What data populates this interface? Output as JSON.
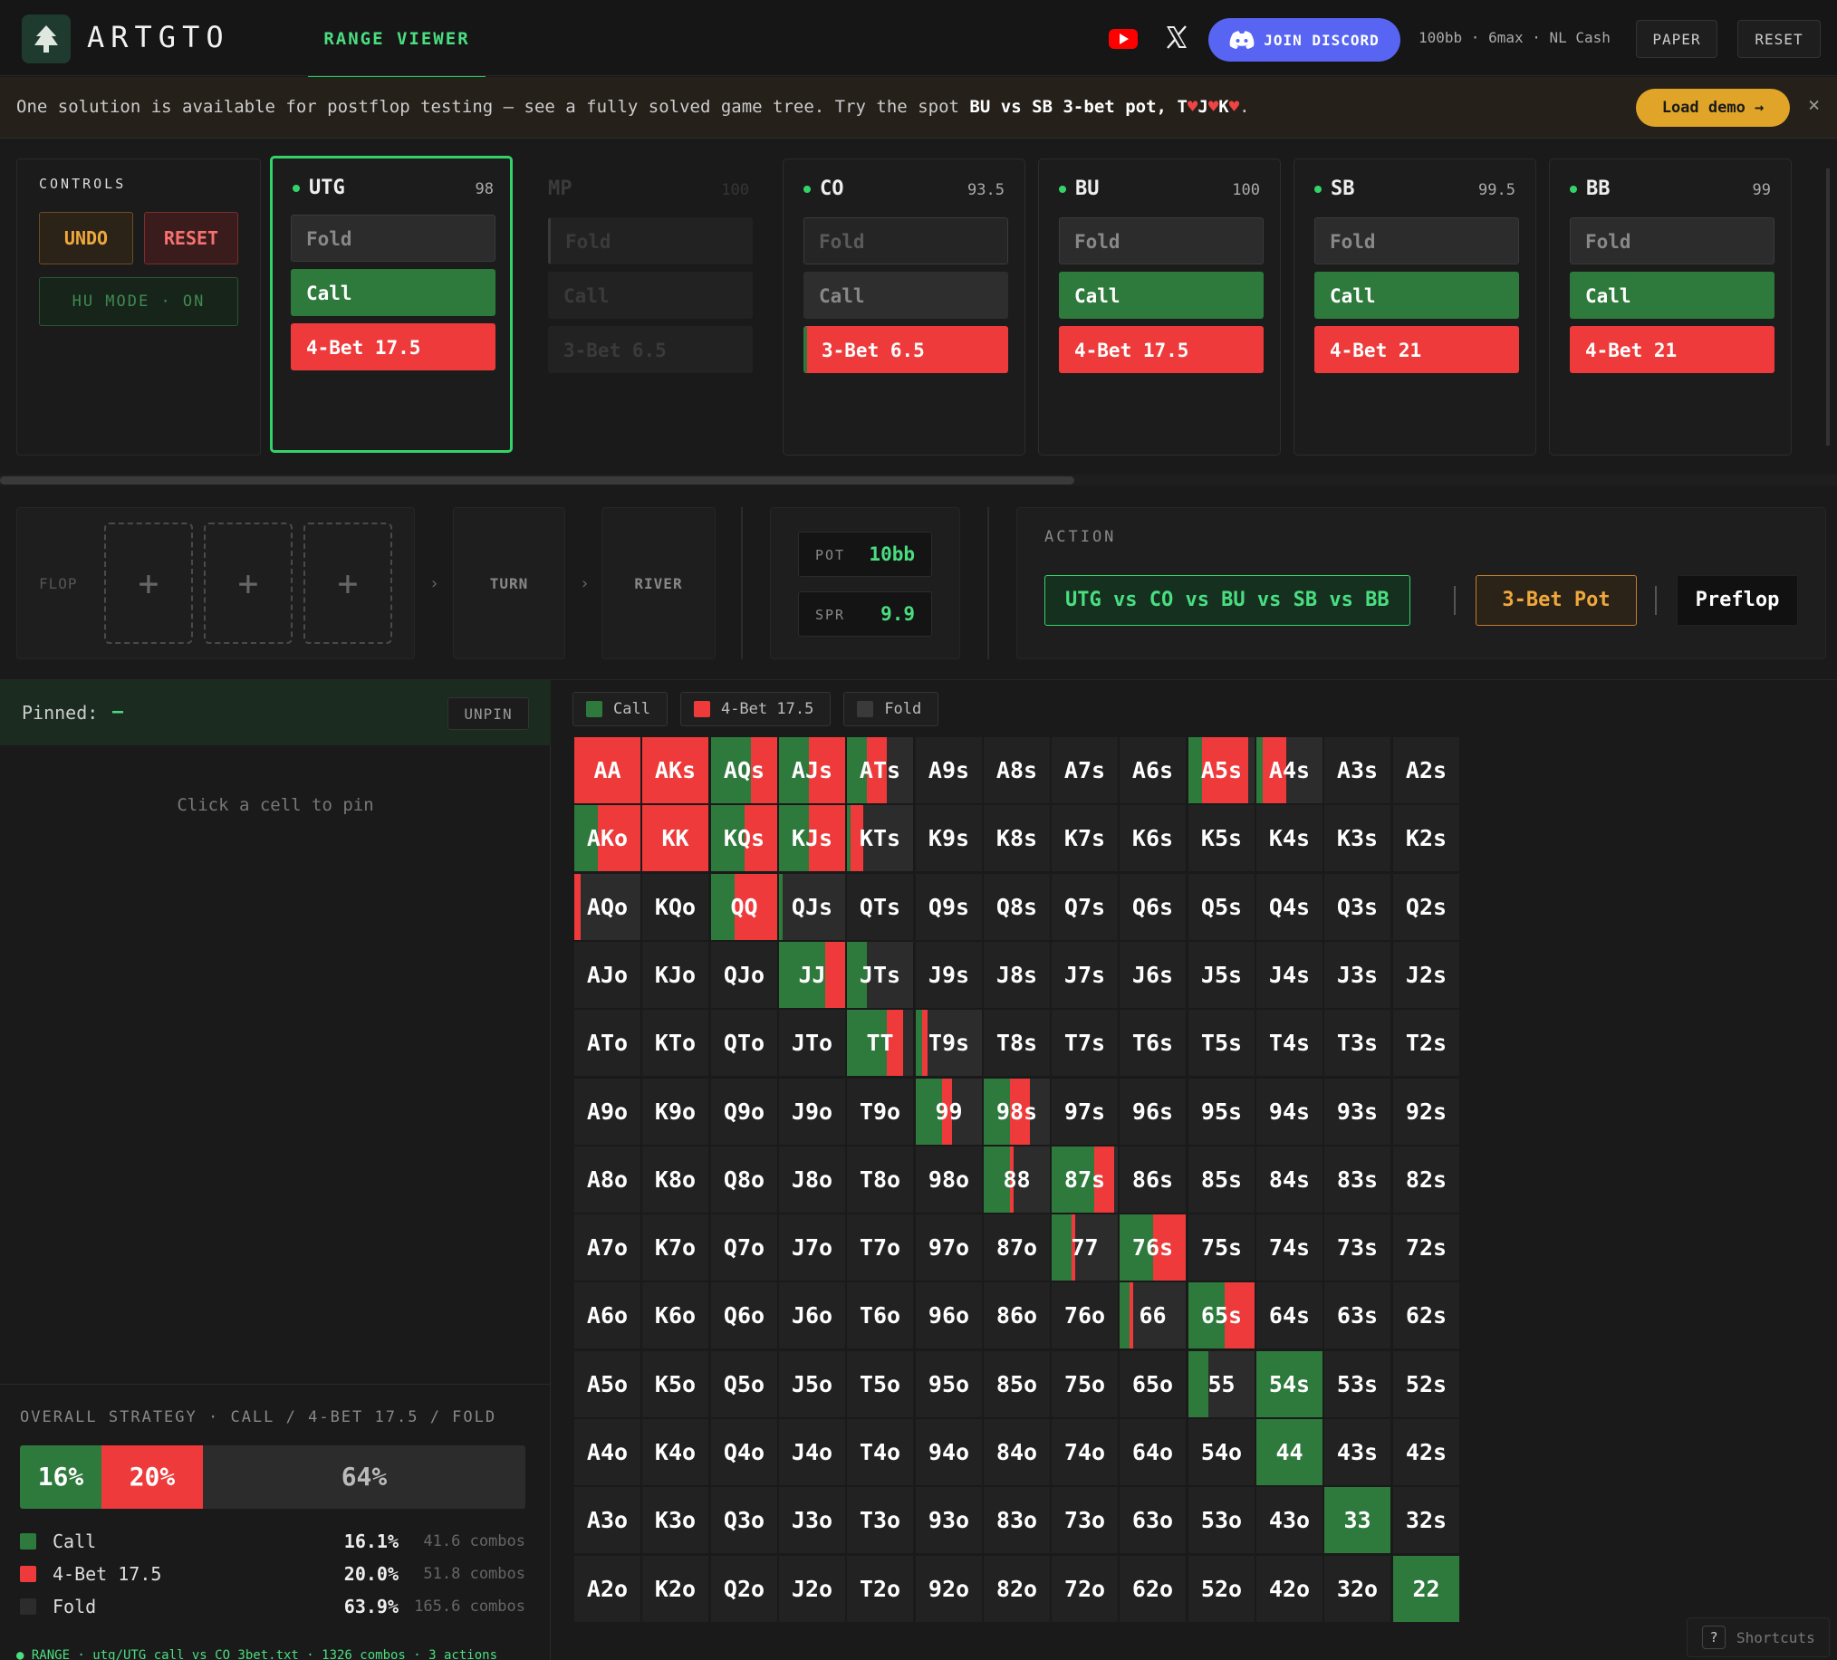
{
  "header": {
    "brand": "ARTGTO",
    "nav_tab": "RANGE VIEWER",
    "discord_label": "JOIN DISCORD",
    "game_info": "100bb · 6max · NL Cash",
    "paper_label": "PAPER",
    "reset_label": "RESET"
  },
  "banner": {
    "text_before": "One solution is available for postflop testing — see a fully solved game tree. Try the spot ",
    "spot": "BU vs SB 3-bet pot, T♥J♥K♥",
    "text_after": ".",
    "load_demo_label": "Load demo →",
    "close_label": "×"
  },
  "controls": {
    "title": "CONTROLS",
    "undo_label": "UNDO",
    "reset_label": "RESET",
    "hu_label": "HU MODE · ON"
  },
  "positions": [
    {
      "name": "UTG",
      "stack": "98",
      "actions": [
        "Fold",
        "Call",
        "4-Bet 17.5"
      ]
    },
    {
      "name": "MP",
      "stack": "100",
      "actions": [
        "Fold",
        "Call",
        "3-Bet 6.5"
      ]
    },
    {
      "name": "CO",
      "stack": "93.5",
      "actions": [
        "Fold",
        "Call",
        "3-Bet 6.5"
      ]
    },
    {
      "name": "BU",
      "stack": "100",
      "actions": [
        "Fold",
        "Call",
        "4-Bet 17.5"
      ]
    },
    {
      "name": "SB",
      "stack": "99.5",
      "actions": [
        "Fold",
        "Call",
        "4-Bet 21"
      ]
    },
    {
      "name": "BB",
      "stack": "99",
      "actions": [
        "Fold",
        "Call",
        "4-Bet 21"
      ]
    }
  ],
  "board": {
    "flop_label": "FLOP",
    "turn_label": "TURN",
    "river_label": "RIVER",
    "add_symbol": "+",
    "chevron": "›"
  },
  "pot": {
    "pot_label": "POT",
    "pot_value": "10bb",
    "spr_label": "SPR",
    "spr_value": "9.9"
  },
  "action": {
    "title": "ACTION",
    "players": "UTG vs CO vs BU vs SB vs BB",
    "pot_type": "3-Bet Pot",
    "street": "Preflop"
  },
  "pinned": {
    "label": "Pinned:",
    "value": "—",
    "unpin_label": "UNPIN",
    "hint": "Click a cell to pin"
  },
  "strategy": {
    "title": "OVERALL STRATEGY · CALL / 4-BET 17.5 / FOLD",
    "call_pct_label": "16%",
    "raise_pct_label": "20%",
    "fold_pct_label": "64%",
    "call_share": 0.161,
    "raise_share": 0.2,
    "fold_share": 0.639,
    "rows": [
      {
        "name": "Call",
        "pct": "16.1%",
        "combos": "41.6 combos",
        "color": "#2d7a3c"
      },
      {
        "name": "4-Bet 17.5",
        "pct": "20.0%",
        "combos": "51.8 combos",
        "color": "#ee3a3a"
      },
      {
        "name": "Fold",
        "pct": "63.9%",
        "combos": "165.6 combos",
        "color": "#2c2c2c"
      }
    ]
  },
  "footer": "● RANGE · utg/UTG_call_vs_CO_3bet.txt · 1326 combos · 3 actions",
  "legend": {
    "call": "Call",
    "raise": "4-Bet 17.5",
    "fold": "Fold"
  },
  "colors": {
    "call": "#2d7a3c",
    "raise": "#ee3a3a",
    "fold": "#2c2c2c",
    "accent": "#34d36a"
  },
  "shortcuts_label": "Shortcuts",
  "grid": {
    "labels": [
      [
        "AA",
        "AKs",
        "AQs",
        "AJs",
        "ATs",
        "A9s",
        "A8s",
        "A7s",
        "A6s",
        "A5s",
        "A4s",
        "A3s",
        "A2s"
      ],
      [
        "AKo",
        "KK",
        "KQs",
        "KJs",
        "KTs",
        "K9s",
        "K8s",
        "K7s",
        "K6s",
        "K5s",
        "K4s",
        "K3s",
        "K2s"
      ],
      [
        "AQo",
        "KQo",
        "QQ",
        "QJs",
        "QTs",
        "Q9s",
        "Q8s",
        "Q7s",
        "Q6s",
        "Q5s",
        "Q4s",
        "Q3s",
        "Q2s"
      ],
      [
        "AJo",
        "KJo",
        "QJo",
        "JJ",
        "JTs",
        "J9s",
        "J8s",
        "J7s",
        "J6s",
        "J5s",
        "J4s",
        "J3s",
        "J2s"
      ],
      [
        "ATo",
        "KTo",
        "QTo",
        "JTo",
        "TT",
        "T9s",
        "T8s",
        "T7s",
        "T6s",
        "T5s",
        "T4s",
        "T3s",
        "T2s"
      ],
      [
        "A9o",
        "K9o",
        "Q9o",
        "J9o",
        "T9o",
        "99",
        "98s",
        "97s",
        "96s",
        "95s",
        "94s",
        "93s",
        "92s"
      ],
      [
        "A8o",
        "K8o",
        "Q8o",
        "J8o",
        "T8o",
        "98o",
        "88",
        "87s",
        "86s",
        "85s",
        "84s",
        "83s",
        "82s"
      ],
      [
        "A7o",
        "K7o",
        "Q7o",
        "J7o",
        "T7o",
        "97o",
        "87o",
        "77",
        "76s",
        "75s",
        "74s",
        "73s",
        "72s"
      ],
      [
        "A6o",
        "K6o",
        "Q6o",
        "J6o",
        "T6o",
        "96o",
        "86o",
        "76o",
        "66",
        "65s",
        "64s",
        "63s",
        "62s"
      ],
      [
        "A5o",
        "K5o",
        "Q5o",
        "J5o",
        "T5o",
        "95o",
        "85o",
        "75o",
        "65o",
        "55",
        "54s",
        "53s",
        "52s"
      ],
      [
        "A4o",
        "K4o",
        "Q4o",
        "J4o",
        "T4o",
        "94o",
        "84o",
        "74o",
        "64o",
        "54o",
        "44",
        "43s",
        "42s"
      ],
      [
        "A3o",
        "K3o",
        "Q3o",
        "J3o",
        "T3o",
        "93o",
        "83o",
        "73o",
        "63o",
        "53o",
        "43o",
        "33",
        "32s"
      ],
      [
        "A2o",
        "K2o",
        "Q2o",
        "J2o",
        "T2o",
        "92o",
        "82o",
        "72o",
        "62o",
        "52o",
        "42o",
        "32o",
        "22"
      ]
    ],
    "strategy": {
      "AA": [
        0,
        1
      ],
      "AKs": [
        0,
        1
      ],
      "AQs": [
        0.6,
        0.4
      ],
      "AJs": [
        0.45,
        0.55
      ],
      "ATs": [
        0.3,
        0.3
      ],
      "A5s": [
        0.2,
        0.7
      ],
      "A4s": [
        0.1,
        0.35
      ],
      "AKo": [
        0.35,
        0.65
      ],
      "KK": [
        0,
        1
      ],
      "KQs": [
        0.5,
        0.5
      ],
      "KJs": [
        0.45,
        0.55
      ],
      "KTs": [
        0.05,
        0.2
      ],
      "AQo": [
        0,
        0.1
      ],
      "QQ": [
        0.35,
        0.65
      ],
      "QJs": [
        0.05,
        0
      ],
      "JJ": [
        0.7,
        0.3
      ],
      "JTs": [
        0.3,
        0
      ],
      "TT": [
        0.6,
        0.25
      ],
      "T9s": [
        0.1,
        0.08
      ],
      "99": [
        0.4,
        0.15
      ],
      "98s": [
        0.4,
        0.3
      ],
      "88": [
        0.4,
        0.05
      ],
      "87s": [
        0.65,
        0.3
      ],
      "77": [
        0.3,
        0.05
      ],
      "76s": [
        0.5,
        0.5
      ],
      "66": [
        0.15,
        0.05
      ],
      "65s": [
        0.55,
        0.45
      ],
      "55": [
        0.3,
        0
      ],
      "54s": [
        1,
        0
      ],
      "44": [
        1,
        0
      ],
      "33": [
        1,
        0
      ],
      "22": [
        1,
        0
      ]
    }
  }
}
